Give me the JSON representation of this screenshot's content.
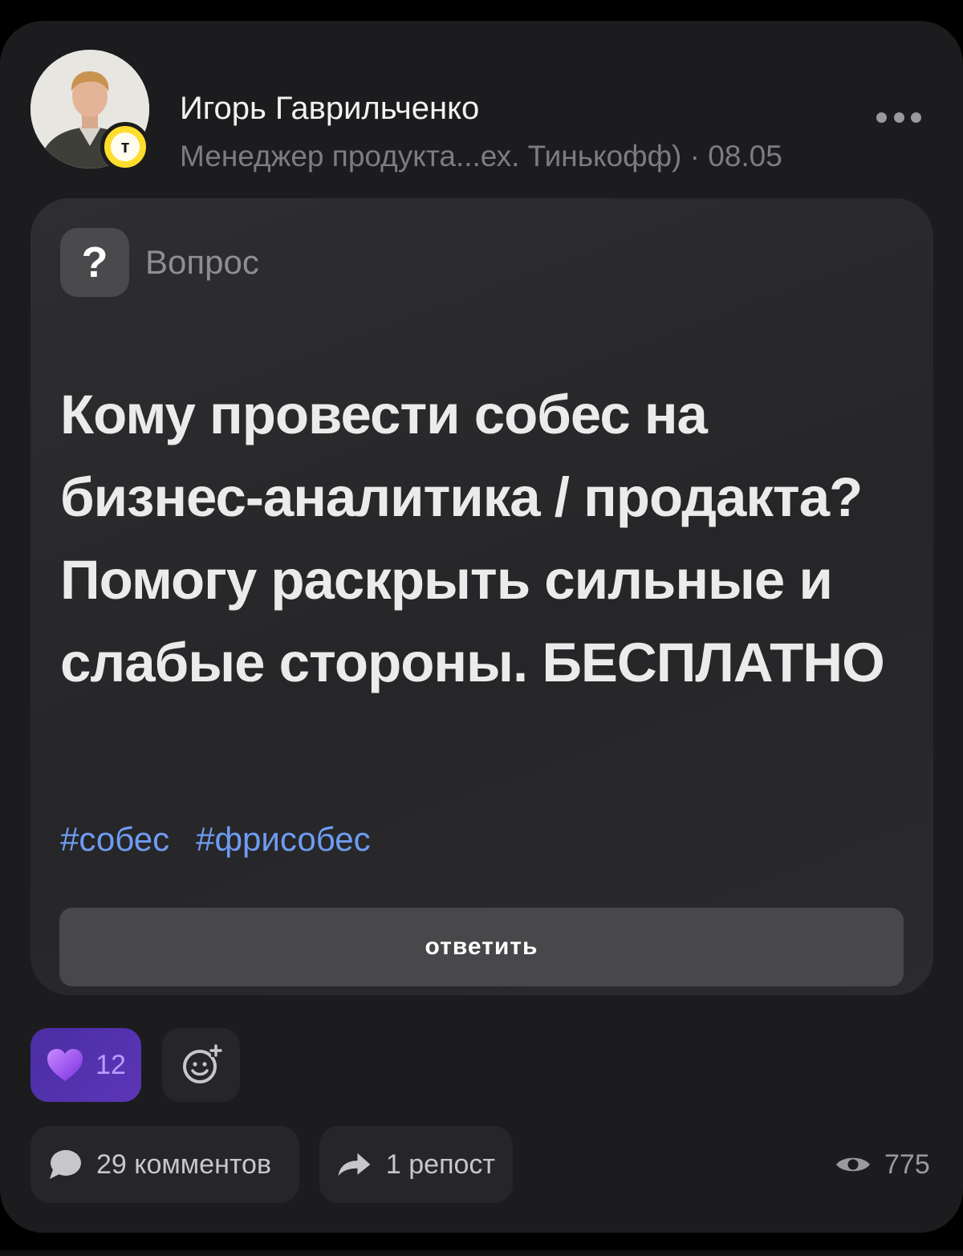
{
  "post": {
    "author": {
      "name": "Игорь Гаврильченко",
      "meta": "Менеджер продукта...ех. Тинькофф) · 08.05",
      "badge_letter": "т"
    },
    "question": {
      "type_label": "Вопрос",
      "icon_glyph": "?",
      "title": "Кому провести собес на бизнес-аналитика / продакта? Помогу раскрыть сильные и слабые стороны. БЕСПЛАТНО",
      "tags": [
        "#собес",
        "#фрисобес"
      ],
      "answer_label": "ответить"
    },
    "reactions": {
      "likes": "12"
    },
    "stats": {
      "comments": "29 комментов",
      "reposts": "1 репост",
      "views": "775"
    }
  },
  "colors": {
    "background": "#000000",
    "card": "#1c1c1e",
    "tag": "#6f9cf2",
    "like_accent": "#5b36b8",
    "badge": "#ffdd2d"
  },
  "icons": [
    "more-dots-icon",
    "question-icon",
    "heart-icon",
    "add-reaction-icon",
    "comment-icon",
    "repost-icon",
    "eye-icon"
  ]
}
